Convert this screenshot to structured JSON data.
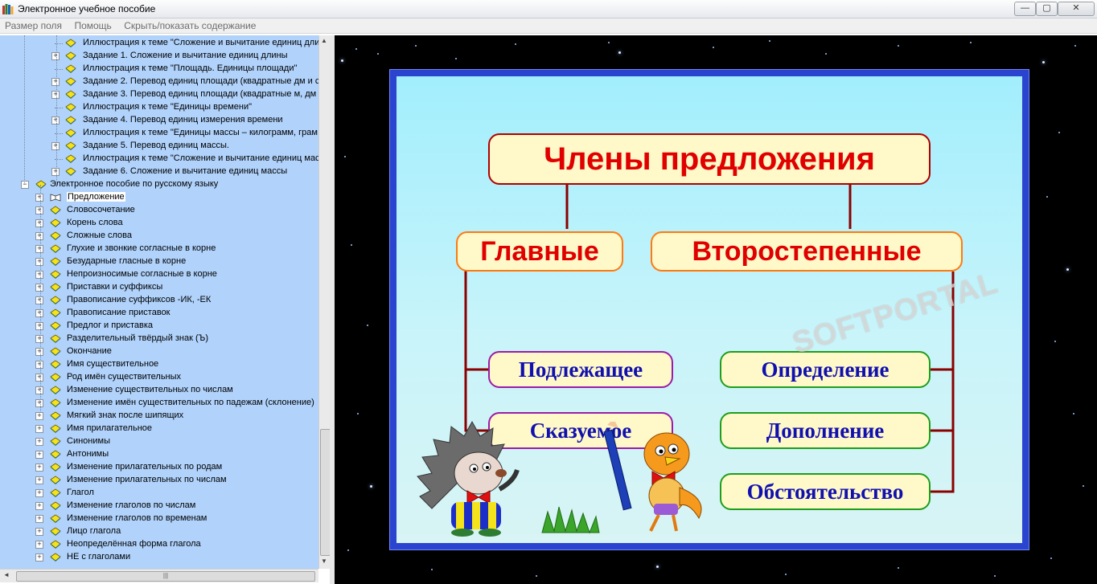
{
  "window": {
    "title": "Электронное учебное пособие",
    "min": "—",
    "max": "▢",
    "close": "✕"
  },
  "menu": [
    "Размер поля",
    "Помощь",
    "Скрыть/показать содержание"
  ],
  "tree": [
    {
      "label": "Иллюстрация к теме \"Сложение и вычитание единиц дли",
      "level": 3,
      "icon": "book-closed",
      "exp": ""
    },
    {
      "label": "Задание 1. Сложение и вычитание единиц длины",
      "level": 3,
      "icon": "book-closed",
      "exp": "+"
    },
    {
      "label": "Иллюстрация к теме \"Площадь. Единицы площади\"",
      "level": 3,
      "icon": "book-closed",
      "exp": ""
    },
    {
      "label": "Задание 2. Перевод единиц площади (квадратные дм и с",
      "level": 3,
      "icon": "book-closed",
      "exp": "+"
    },
    {
      "label": "Задание 3. Перевод единиц площади (квадратные м, дм",
      "level": 3,
      "icon": "book-closed",
      "exp": "+"
    },
    {
      "label": "Иллюстрация к теме \"Единицы времени\"",
      "level": 3,
      "icon": "book-closed",
      "exp": ""
    },
    {
      "label": "Задание 4. Перевод единиц измерения времени",
      "level": 3,
      "icon": "book-closed",
      "exp": "+"
    },
    {
      "label": "Иллюстрация к теме \"Единицы массы – килограмм, грам",
      "level": 3,
      "icon": "book-closed",
      "exp": ""
    },
    {
      "label": "Задание 5. Перевод единиц массы.",
      "level": 3,
      "icon": "book-closed",
      "exp": "+"
    },
    {
      "label": "Иллюстрация к теме \"Сложение и вычитание единиц мас",
      "level": 3,
      "icon": "book-closed",
      "exp": ""
    },
    {
      "label": "Задание 6. Сложение и вычитание единиц массы",
      "level": 3,
      "icon": "book-closed",
      "exp": "+"
    },
    {
      "label": "Электронное пособие по русскому языку",
      "level": 1,
      "icon": "book-closed",
      "exp": "−"
    },
    {
      "label": "Предложение",
      "level": 2,
      "icon": "book-open",
      "exp": "+",
      "selected": true
    },
    {
      "label": "Словосочетание",
      "level": 2,
      "icon": "book-closed",
      "exp": "+"
    },
    {
      "label": "Корень слова",
      "level": 2,
      "icon": "book-closed",
      "exp": "+"
    },
    {
      "label": "Сложные слова",
      "level": 2,
      "icon": "book-closed",
      "exp": "+"
    },
    {
      "label": "Глухие и звонкие согласные в корне",
      "level": 2,
      "icon": "book-closed",
      "exp": "+"
    },
    {
      "label": "Безударные гласные в корне",
      "level": 2,
      "icon": "book-closed",
      "exp": "+"
    },
    {
      "label": "Непроизносимые согласные в корне",
      "level": 2,
      "icon": "book-closed",
      "exp": "+"
    },
    {
      "label": "Приставки и суффиксы",
      "level": 2,
      "icon": "book-closed",
      "exp": "+"
    },
    {
      "label": "Правописание суффиксов -ИК, -ЕК",
      "level": 2,
      "icon": "book-closed",
      "exp": "+"
    },
    {
      "label": "Правописание приставок",
      "level": 2,
      "icon": "book-closed",
      "exp": "+"
    },
    {
      "label": "Предлог и приставка",
      "level": 2,
      "icon": "book-closed",
      "exp": "+"
    },
    {
      "label": "Разделительный твёрдый знак (Ъ)",
      "level": 2,
      "icon": "book-closed",
      "exp": "+"
    },
    {
      "label": "Окончание",
      "level": 2,
      "icon": "book-closed",
      "exp": "+"
    },
    {
      "label": "Имя существительное",
      "level": 2,
      "icon": "book-closed",
      "exp": "+"
    },
    {
      "label": "Род имён существительных",
      "level": 2,
      "icon": "book-closed",
      "exp": "+"
    },
    {
      "label": "Изменение существительных по числам",
      "level": 2,
      "icon": "book-closed",
      "exp": "+"
    },
    {
      "label": "Изменение имён существительных по падежам (склонение)",
      "level": 2,
      "icon": "book-closed",
      "exp": "+"
    },
    {
      "label": "Мягкий знак после шипящих",
      "level": 2,
      "icon": "book-closed",
      "exp": "+"
    },
    {
      "label": "Имя прилагательное",
      "level": 2,
      "icon": "book-closed",
      "exp": "+"
    },
    {
      "label": "Синонимы",
      "level": 2,
      "icon": "book-closed",
      "exp": "+"
    },
    {
      "label": "Антонимы",
      "level": 2,
      "icon": "book-closed",
      "exp": "+"
    },
    {
      "label": "Изменение прилагательных по родам",
      "level": 2,
      "icon": "book-closed",
      "exp": "+"
    },
    {
      "label": "Изменение прилагательных по числам",
      "level": 2,
      "icon": "book-closed",
      "exp": "+"
    },
    {
      "label": "Глагол",
      "level": 2,
      "icon": "book-closed",
      "exp": "+"
    },
    {
      "label": "Изменение глаголов по числам",
      "level": 2,
      "icon": "book-closed",
      "exp": "+"
    },
    {
      "label": "Изменение глаголов по временам",
      "level": 2,
      "icon": "book-closed",
      "exp": "+"
    },
    {
      "label": "Лицо глагола",
      "level": 2,
      "icon": "book-closed",
      "exp": "+"
    },
    {
      "label": "Неопределённая форма глагола",
      "level": 2,
      "icon": "book-closed",
      "exp": "+"
    },
    {
      "label": "НЕ с глаголами",
      "level": 2,
      "icon": "book-closed",
      "exp": "+"
    }
  ],
  "scroll": {
    "up": "▲",
    "down": "▼",
    "left": "◄",
    "right": "►",
    "grip": "|||"
  },
  "slide": {
    "title": "Члены предложения",
    "main": "Главные",
    "secondary": "Второстепенные",
    "subject": "Подлежащее",
    "predicate": "Сказуемое",
    "attribute": "Определение",
    "object": "Дополнение",
    "adverbial": "Обстоятельство",
    "watermark": "SOFTPORTAL"
  },
  "colors": {
    "tree_bg": "#b0d2fb",
    "board_frame": "#2b44d0",
    "title_text": "#e00000",
    "sub_text": "#1010b0",
    "connector": "#8b0000"
  }
}
